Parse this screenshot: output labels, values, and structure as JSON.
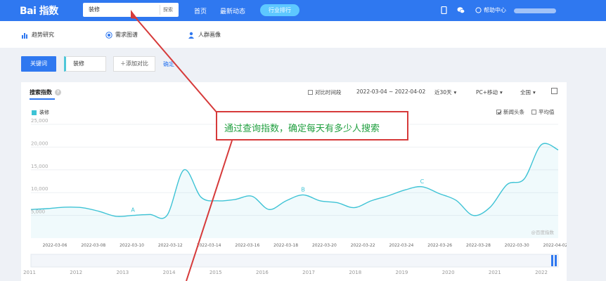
{
  "header": {
    "logo_text": "Bai 指数",
    "search_value": "装修",
    "search_button": "探索",
    "nav": [
      "首页",
      "最新动态"
    ],
    "industry_button": "行业排行",
    "help_label": "帮助中心"
  },
  "subnav": {
    "items": [
      "趋势研究",
      "需求图谱",
      "人群画像"
    ]
  },
  "keyword_bar": {
    "tag": "关键词",
    "keyword": "装修",
    "add_compare": "＋添加对比",
    "confirm": "确定"
  },
  "panel": {
    "title": "搜索指数",
    "controls": {
      "compare_period": "对比时间段",
      "date_range": "2022-03-04 ~ 2022-04-02",
      "period": "近30天",
      "device": "PC+移动",
      "region": "全国"
    },
    "options": {
      "news_headlines": "新闻头条",
      "average": "平均值"
    },
    "watermark": "@百度指数",
    "overview_years": [
      "2011",
      "2012",
      "2013",
      "2014",
      "2015",
      "2016",
      "2017",
      "2018",
      "2019",
      "2020",
      "2021",
      "2022"
    ]
  },
  "annotation": {
    "text": "通过查询指数，确定每天有多少人搜索"
  },
  "colors": {
    "brand": "#2f78f0",
    "series": "#3ec3d5",
    "annotation_border": "#d63a3a",
    "annotation_text": "#21a040"
  },
  "chart_data": {
    "type": "area",
    "series": [
      {
        "name": "装修",
        "values": [
          6300,
          6500,
          6800,
          6700,
          5900,
          4800,
          5000,
          5200,
          5000,
          15000,
          9000,
          8200,
          8500,
          9200,
          6300,
          8200,
          9500,
          8200,
          7800,
          6700,
          8200,
          9300,
          10600,
          11300,
          9800,
          8300,
          5000,
          6800,
          11800,
          13000,
          20500,
          19400
        ]
      }
    ],
    "x_tick_labels": [
      "2022-03-06",
      "2022-03-08",
      "2022-03-10",
      "2022-03-12",
      "2022-03-14",
      "2022-03-16",
      "2022-03-18",
      "2022-03-20",
      "2022-03-22",
      "2022-03-24",
      "2022-03-26",
      "2022-03-28",
      "2022-03-30",
      "2022-04-02"
    ],
    "y_ticks": [
      "5,000",
      "10,000",
      "15,000",
      "20,000",
      "25,000"
    ],
    "ylim": [
      0,
      25000
    ],
    "annotations": [
      {
        "label": "A",
        "index": 6
      },
      {
        "label": "B",
        "index": 16
      },
      {
        "label": "C",
        "index": 23
      }
    ],
    "grid": true
  }
}
